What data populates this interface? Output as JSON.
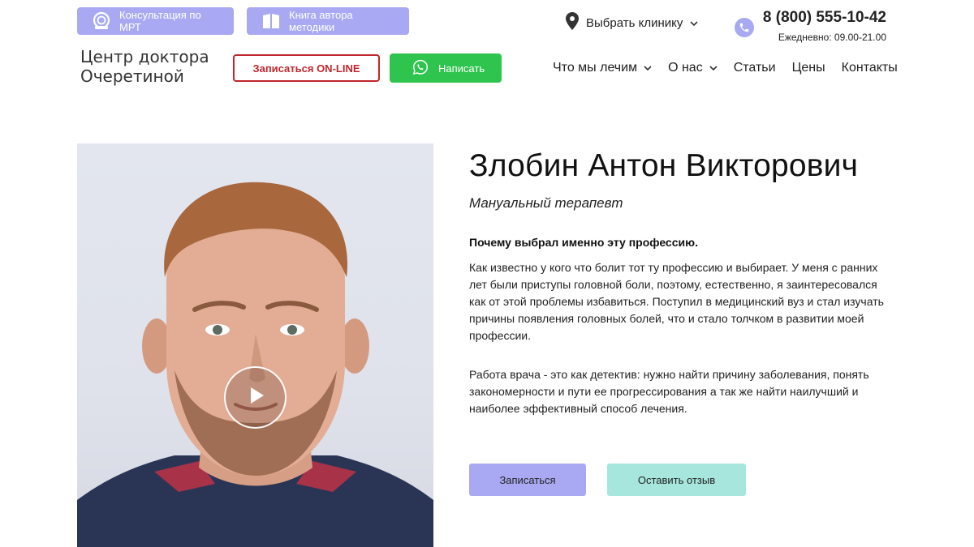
{
  "colors": {
    "accent_lavender": "#a9a9f3",
    "accent_mint": "#a6e6dd",
    "whatsapp_green": "#2ec44e",
    "online_red": "#c0262d"
  },
  "header": {
    "mri_button": {
      "label": "Консультация по МРТ",
      "icon": "mri-scanner-icon"
    },
    "book_button": {
      "label": "Книга автора методики",
      "icon": "book-icon"
    },
    "clinic_select": {
      "label": "Выбрать клинику",
      "icon": "location-pin-icon"
    },
    "phone": {
      "number": "8 (800) 555-10-42",
      "hours": "Ежедневно: 09.00-21.00",
      "icon": "phone-icon"
    },
    "logo_line1": "Центр доктора",
    "logo_line2": "Очеретиной",
    "online_button": "Записаться ON-LINE",
    "whatsapp_button": {
      "label": "Написать",
      "icon": "whatsapp-icon"
    },
    "nav": [
      "Что мы лечим",
      "О нас",
      "Статьи",
      "Цены",
      "Контакты"
    ]
  },
  "doctor": {
    "name": "Злобин Антон Викторович",
    "specialty": "Мануальный терапевт",
    "why_title": "Почему выбрал именно эту профессию.",
    "paragraph1": "Как известно у кого что болит тот ту профессию и выбирает. У меня с ранних лет были приступы головной боли, поэтому, естественно, я заинтересовался как от этой проблемы избавиться. Поступил в медицинский вуз и стал изучать причины появления головных болей, что и стало толчком в развитии моей профессии.",
    "paragraph2": "Работа врача - это как детектив: нужно найти причину заболевания, понять закономерности и пути ее прогрессирования а так же найти наилучший и наиболее эффективный способ лечения.",
    "book_button": "Записаться",
    "review_button": "Оставить отзыв",
    "video_play_icon": "play-icon"
  }
}
